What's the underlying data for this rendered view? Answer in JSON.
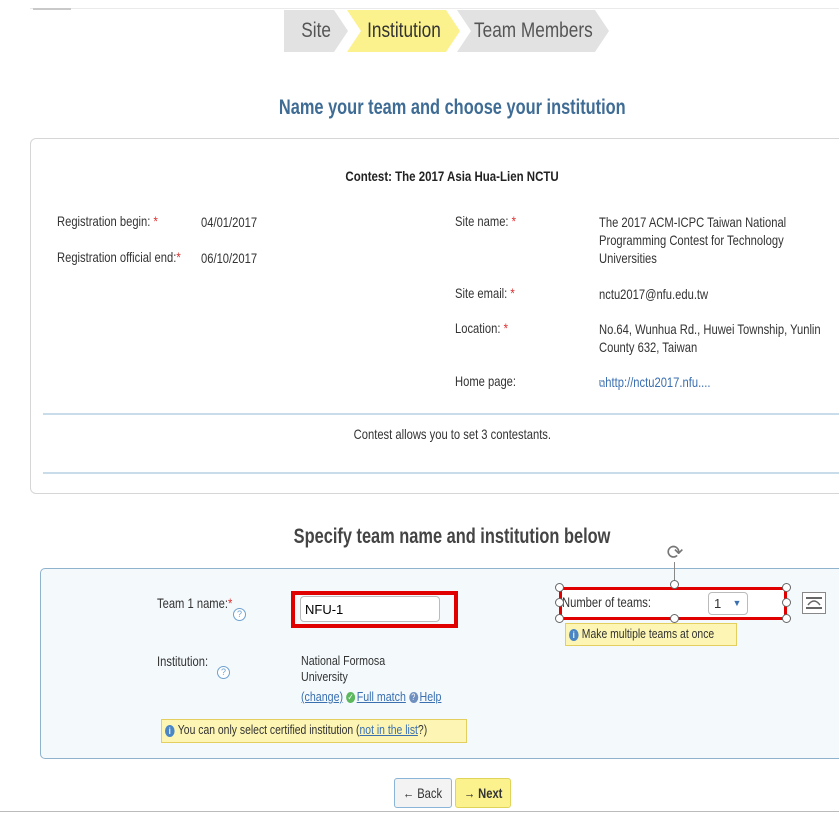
{
  "steps": [
    "Site",
    "Institution",
    "Team Members"
  ],
  "page_title": "Name your team and choose your institution",
  "contest": {
    "title": "Contest: The 2017 Asia Hua-Lien NCTU",
    "reg_begin_label": "Registration begin:",
    "reg_begin_value": "04/01/2017",
    "reg_end_label": "Registration official end:",
    "reg_end_value": "06/10/2017",
    "site_name_label": "Site name:",
    "site_name_value": "The 2017 ACM-ICPC Taiwan National Programming Contest for Technology Universities",
    "site_email_label": "Site email:",
    "site_email_value": "nctu2017@nfu.edu.tw",
    "location_label": "Location:",
    "location_value": "No.64, Wunhua Rd., Huwei Township, Yunlin County 632, Taiwan",
    "home_page_label": "Home page:",
    "home_page_value": "http://nctu2017.nfu....",
    "allows_text": "Contest allows you to set 3 contestants.",
    "required_mark": "*"
  },
  "form": {
    "section_title": "Specify team name and institution below",
    "team_label": "Team 1 name:",
    "team_value": "NFU-1",
    "institution_label": "Institution:",
    "institution_value_line1": "National Formosa",
    "institution_value_line2": "University",
    "change_link": "(change)",
    "full_match_link": "Full match",
    "help_link": "Help",
    "certified_note_prefix": "You can only select certified institution (",
    "certified_note_link": "not in the list",
    "certified_note_suffix": "?)",
    "number_of_teams_label": "Number of teams:",
    "number_of_teams_value": "1",
    "multiple_teams_tip": "Make multiple teams at once"
  },
  "buttons": {
    "back": "← Back",
    "next": "→ Next"
  },
  "icons": {
    "help": "question-circle-icon",
    "info": "info-icon",
    "external_link": "external-link-icon",
    "dropdown": "chevron-down-icon",
    "rotate": "rotate-icon",
    "layout": "layout-options-icon"
  },
  "colors": {
    "active_step": "#fbf28d",
    "title_blue": "#3f6c95",
    "highlight_red": "#e00000"
  }
}
